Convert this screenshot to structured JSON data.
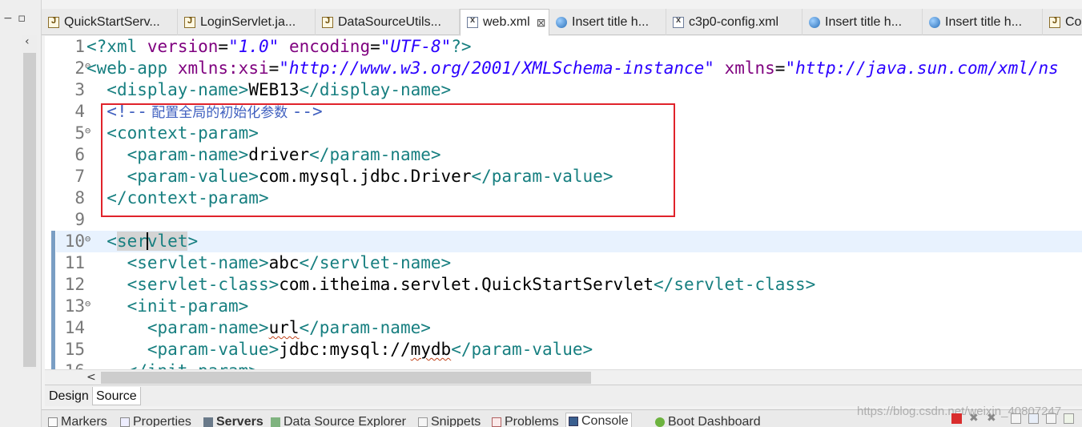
{
  "editor_tabs": [
    {
      "label": "QuickStartServ...",
      "icon": "java-file-icon",
      "active": false
    },
    {
      "label": "LoginServlet.ja...",
      "icon": "java-file-icon",
      "active": false
    },
    {
      "label": "DataSourceUtils...",
      "icon": "java-file-icon",
      "active": false
    },
    {
      "label": "web.xml",
      "icon": "xml-file-icon",
      "active": true,
      "close": "⊠"
    },
    {
      "label": "Insert title h...",
      "icon": "browser-icon",
      "active": false
    },
    {
      "label": "c3p0-config.xml",
      "icon": "xml-file-icon",
      "active": false
    },
    {
      "label": "Insert title h...",
      "icon": "browser-icon",
      "active": false
    },
    {
      "label": "Insert title h...",
      "icon": "browser-icon",
      "active": false
    },
    {
      "label": "Co",
      "icon": "java-file-icon",
      "active": false
    }
  ],
  "gutter": {
    "line_numbers": [
      "1",
      "2",
      "3",
      "4",
      "5",
      "6",
      "7",
      "8",
      "9",
      "10",
      "11",
      "12",
      "13",
      "14",
      "15",
      "16"
    ],
    "fold_markers": {
      "line2": "⊖",
      "line5": "⊖",
      "line10": "⊖",
      "line13": "⊖"
    }
  },
  "code": {
    "l1": {
      "open": "<?",
      "name": "xml",
      "attr1": "version",
      "eq": "=",
      "val1": "\"1.0\"",
      "attr2": "encoding",
      "val2": "\"UTF-8\"",
      "close": "?>"
    },
    "l2": {
      "tag": "<web-app",
      "attr1": "xmlns:xsi",
      "eq": "=",
      "val1": "\"http://www.w3.org/2001/XMLSchema-instance\"",
      "attr2": "xmlns",
      "val2": "\"http://java.sun.com/xml/ns"
    },
    "l3": {
      "open": "<display-name>",
      "text": "WEB13",
      "close": "</display-name>"
    },
    "l4": {
      "open": "<!--",
      "text": " 配置全局的初始化参数 ",
      "close": "-->"
    },
    "l5": {
      "tag": "<context-param>"
    },
    "l6": {
      "open": "<param-name>",
      "text": "driver",
      "close": "</param-name>"
    },
    "l7": {
      "open": "<param-value>",
      "text": "com.mysql.jdbc.Driver",
      "close": "</param-value>"
    },
    "l8": {
      "tag": "</context-param>"
    },
    "l10": {
      "open": "<",
      "before": "ser",
      "after": "vlet",
      "close": ">"
    },
    "l11": {
      "open": "<servlet-name>",
      "text": "abc",
      "close": "</servlet-name>"
    },
    "l12": {
      "open": "<servlet-class>",
      "text": "com.itheima.servlet.QuickStartServlet",
      "close": "</servlet-class>"
    },
    "l13": {
      "tag": "<init-param>"
    },
    "l14": {
      "open": "<param-name>",
      "text": "url",
      "close": "</param-name>"
    },
    "l15": {
      "open": "<param-value>",
      "text_a": "jdbc:mysql://",
      "text_b": "mydb",
      "close": "</param-value>"
    },
    "l16": {
      "tag": "</init-param>"
    }
  },
  "editor_mode_tabs": [
    {
      "label": "Design",
      "active": false
    },
    {
      "label": "Source",
      "active": true
    }
  ],
  "view_tabs": [
    {
      "label": "Markers",
      "icon": "markers-icon",
      "active": false
    },
    {
      "label": "Properties",
      "icon": "properties-icon",
      "active": false
    },
    {
      "label": "Servers",
      "icon": "servers-icon",
      "active": false,
      "bold": true
    },
    {
      "label": "Data Source Explorer",
      "icon": "data-source-icon",
      "active": false
    },
    {
      "label": "Snippets",
      "icon": "snippets-icon",
      "active": false
    },
    {
      "label": "Problems",
      "icon": "problems-icon",
      "active": false
    },
    {
      "label": "Console",
      "icon": "console-icon",
      "active": true
    },
    {
      "label": "Boot Dashboard",
      "icon": "boot-dashboard-icon",
      "active": false
    }
  ],
  "watermark": "https://blog.csdn.net/weixin_40807247",
  "colors": {
    "tag": "#177f80",
    "attribute": "#7f007f",
    "value": "#2a00ff",
    "comment": "#3f5fbf",
    "highlight_box": "#e0232b",
    "current_line": "#e8f2fe"
  }
}
